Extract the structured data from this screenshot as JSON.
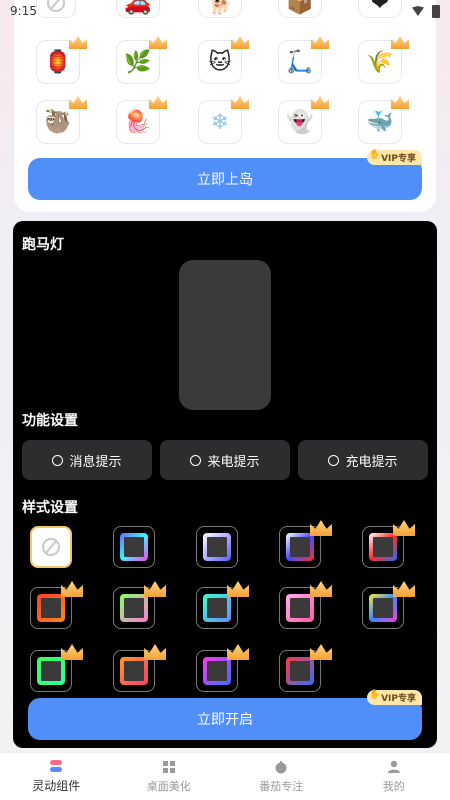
{
  "status": {
    "time": "9:15"
  },
  "top": {
    "button_label": "立即上岛",
    "vip_label": "VIP专享",
    "stickers_row1": [
      "🏮",
      "🌿",
      "🐱",
      "🛴",
      "🌾"
    ],
    "stickers_row2": [
      "🦥",
      "🪼",
      "❄",
      "👻",
      "🐳"
    ]
  },
  "dynamic": {
    "marquee_title": "跑马灯",
    "function_title": "功能设置",
    "functions": [
      {
        "label": "消息提示"
      },
      {
        "label": "来电提示"
      },
      {
        "label": "充电提示"
      }
    ],
    "style_title": "样式设置",
    "start_button": "立即开启",
    "vip_label": "VIP专享"
  },
  "tabs": [
    {
      "label": "灵动组件",
      "active": true,
      "icon": "widget-icon"
    },
    {
      "label": "桌面美化",
      "active": false,
      "icon": "grid-icon"
    },
    {
      "label": "番茄专注",
      "active": false,
      "icon": "tomato-icon"
    },
    {
      "label": "我的",
      "active": false,
      "icon": "user-icon"
    }
  ],
  "colors": {
    "accent": "#4f8ff7",
    "vip": "#fde6a8"
  }
}
